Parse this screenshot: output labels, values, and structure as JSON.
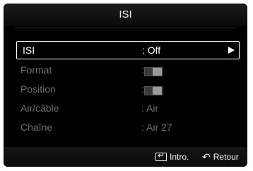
{
  "header": {
    "title": "ISI"
  },
  "menu": {
    "items": [
      {
        "label": "ISI",
        "value": ": Off"
      },
      {
        "label": "Format",
        "value": ":"
      },
      {
        "label": "Position",
        "value": ":"
      },
      {
        "label": "Air/câble",
        "value": ": Air"
      },
      {
        "label": "Chaîne",
        "value": ": Air 27"
      }
    ]
  },
  "footer": {
    "enter_label": "Intro.",
    "return_label": "Retour"
  },
  "icons": {
    "arrow": "right-arrow-icon",
    "enter": "enter-icon",
    "return": "return-icon"
  },
  "colors": {
    "background": "#000000",
    "selected_text": "#ffffff",
    "disabled_text": "#6f6f6f"
  }
}
